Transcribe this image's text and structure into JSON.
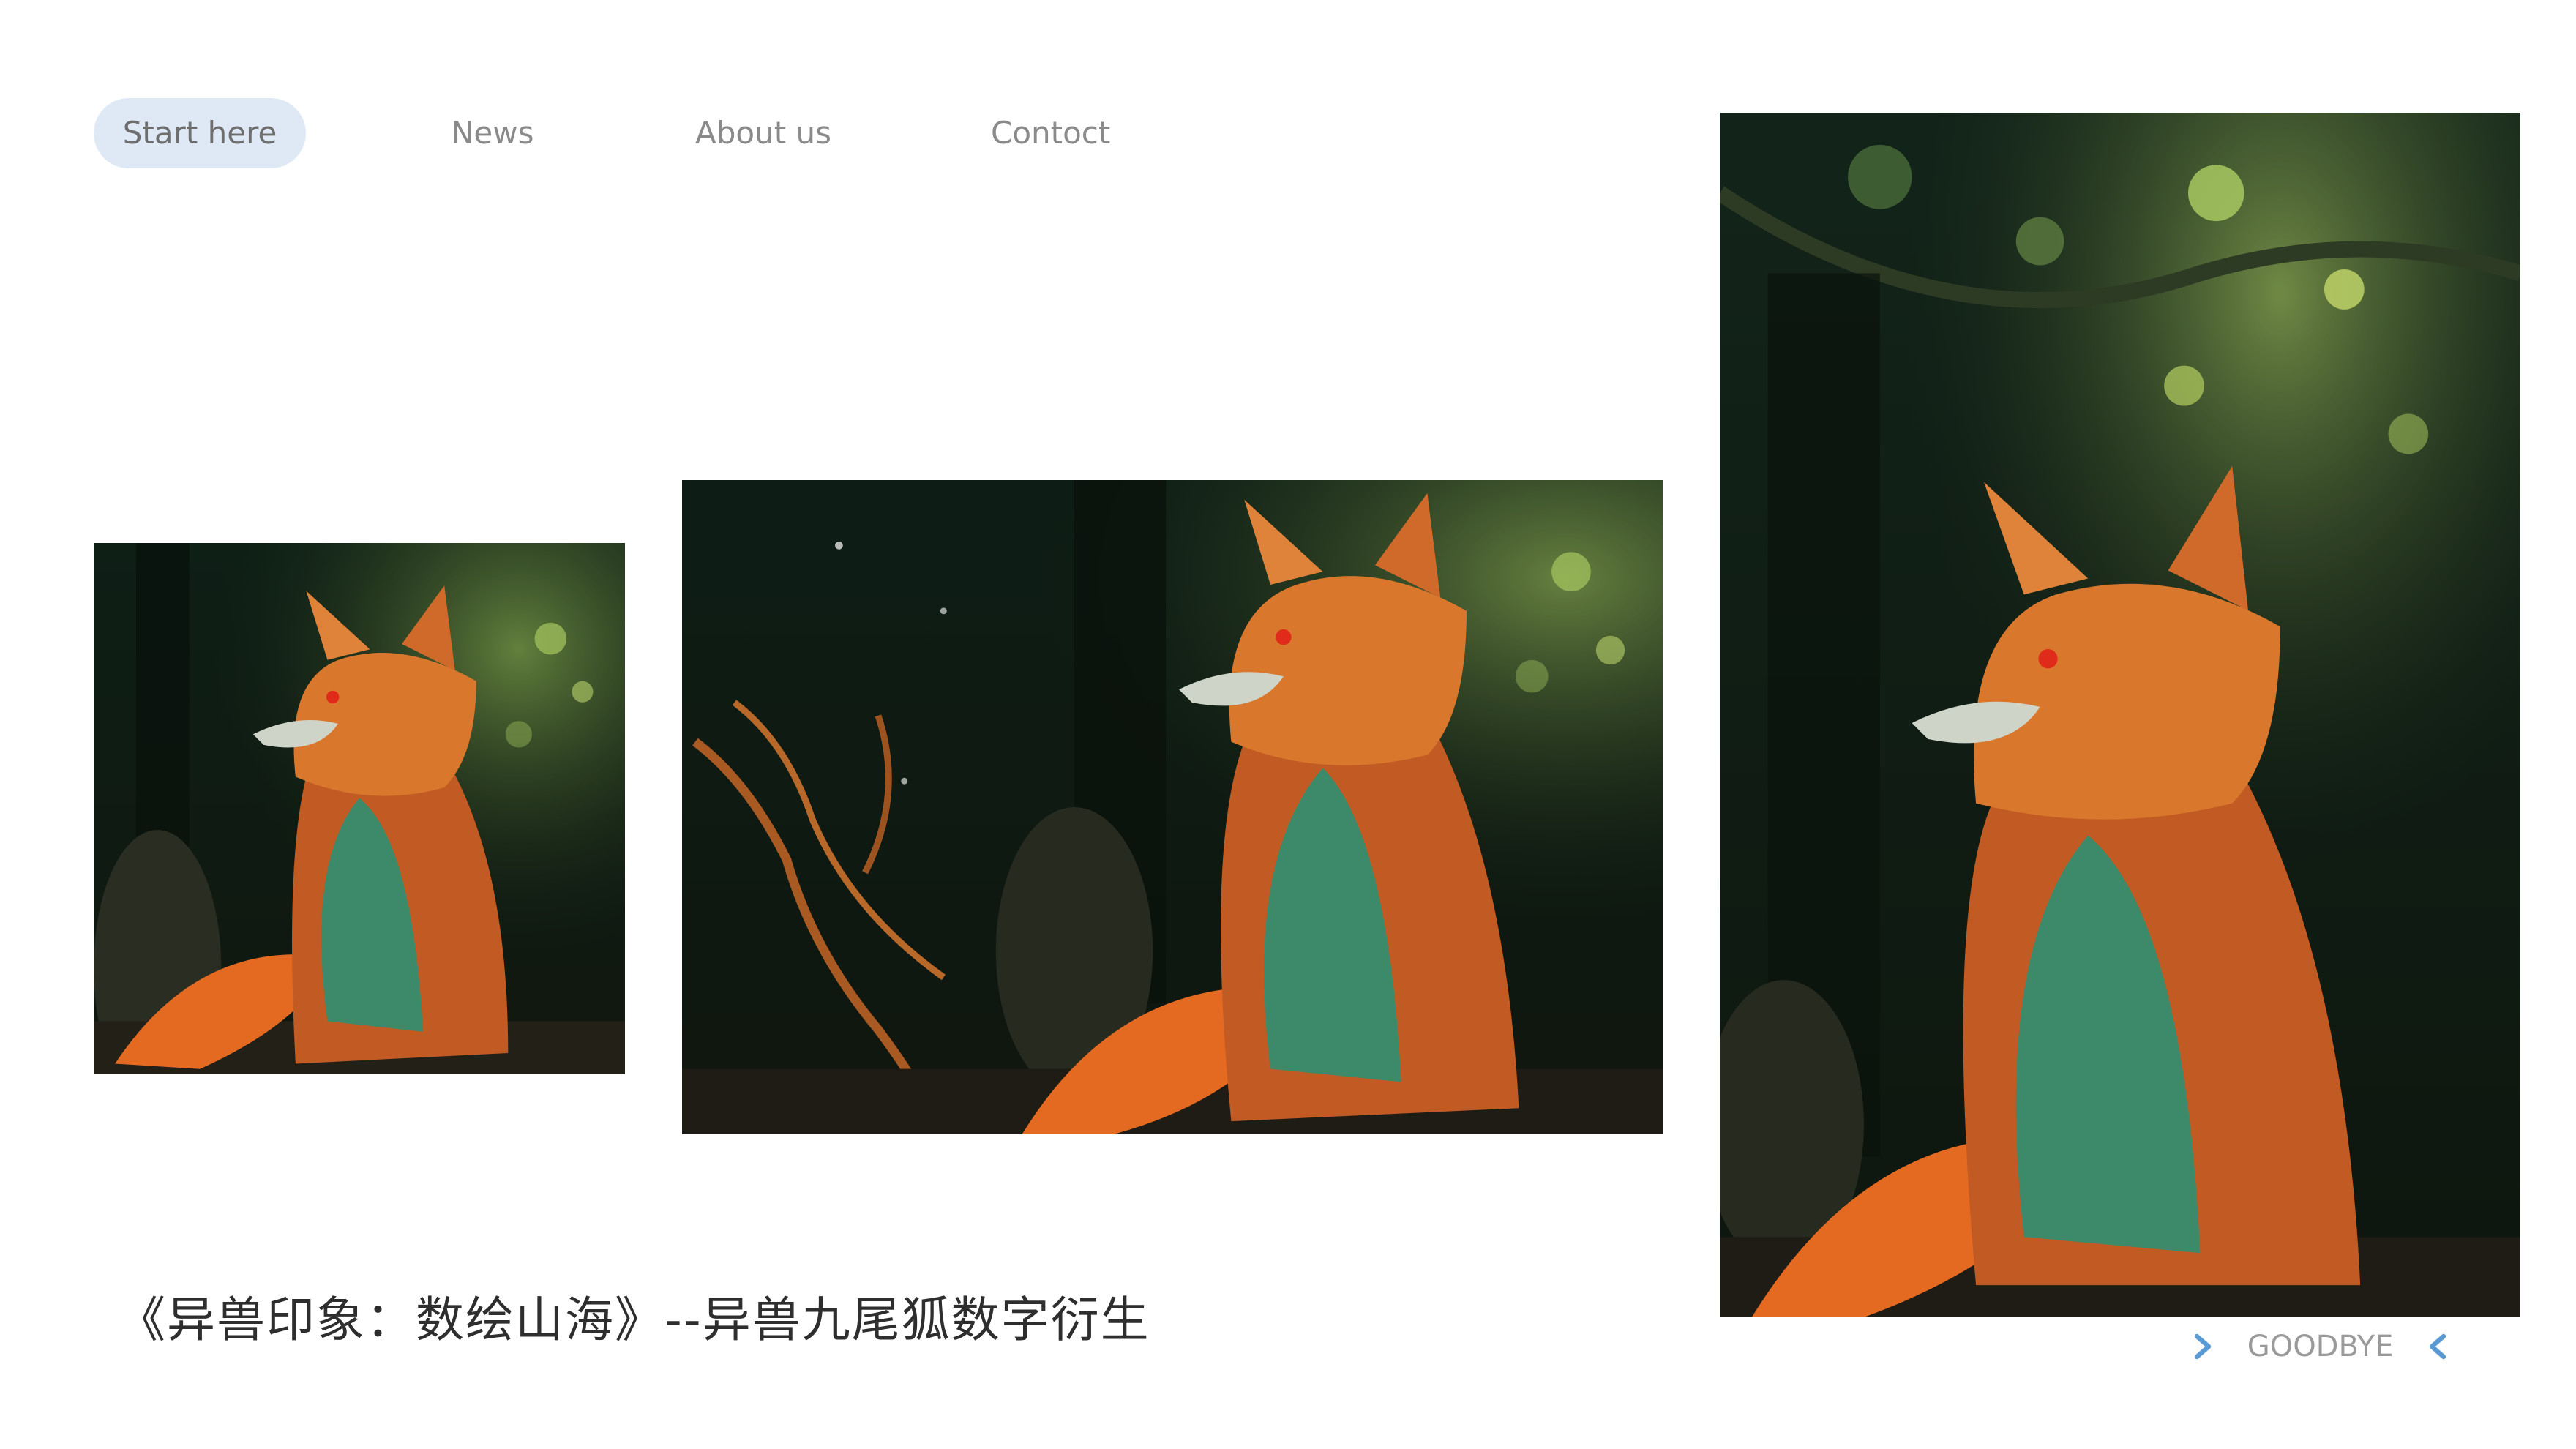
{
  "nav": {
    "items": [
      {
        "label": "Start here",
        "active": true
      },
      {
        "label": "News",
        "active": false
      },
      {
        "label": "About us",
        "active": false
      },
      {
        "label": "Contoct",
        "active": false
      }
    ]
  },
  "gallery": {
    "images": [
      {
        "subject": "nine-tailed fox in forest",
        "shape": "square"
      },
      {
        "subject": "nine-tailed fox in forest",
        "shape": "landscape"
      },
      {
        "subject": "nine-tailed fox in forest",
        "shape": "portrait"
      }
    ]
  },
  "caption": {
    "text": "《异兽印象：数绘山海》--异兽九尾狐数字衍生"
  },
  "footer": {
    "label": "GOODBYE",
    "left_icon": "chevron-right-icon",
    "right_icon": "chevron-left-icon"
  },
  "colors": {
    "active_pill": "#dfe9f5",
    "nav_text": "#8a8a8a",
    "chevron": "#5b9bd5",
    "caption_text": "#2e2e2e"
  }
}
